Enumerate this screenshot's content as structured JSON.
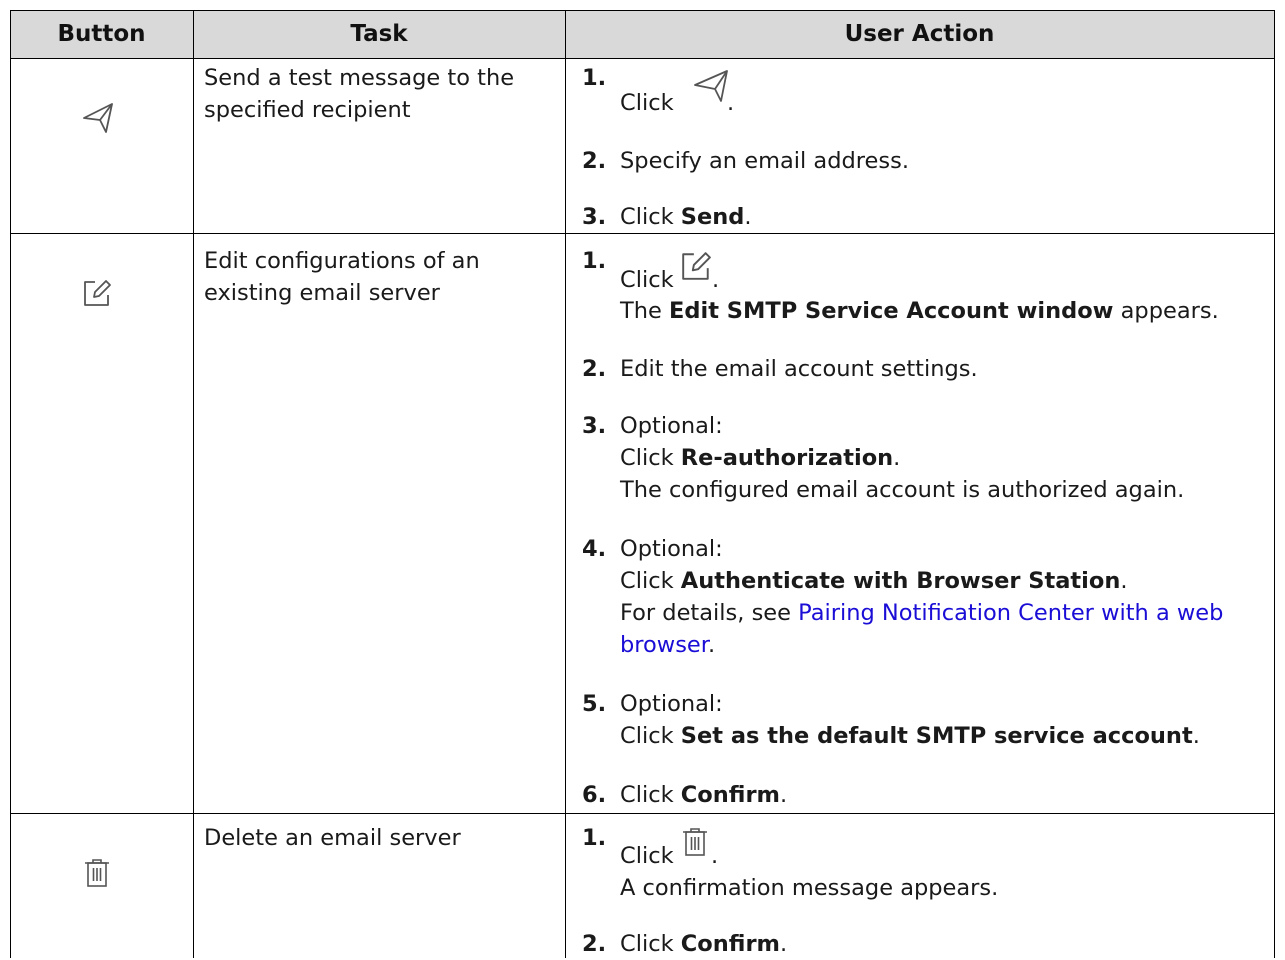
{
  "header": {
    "button": "Button",
    "task": "Task",
    "user_action": "User Action"
  },
  "rows": [
    {
      "icon": "send-icon",
      "task_lines": [
        "Send a test message to the",
        "specified recipient"
      ],
      "steps": [
        {
          "num": "1.",
          "click": "Click",
          "period": "."
        },
        {
          "num": "2.",
          "text": "Specify an email address."
        },
        {
          "num": "3.",
          "click": "Click",
          "bold": "Send",
          "period": "."
        }
      ]
    },
    {
      "icon": "edit-icon",
      "task_lines": [
        "Edit configurations of an",
        "existing email server"
      ],
      "steps": [
        {
          "num": "1.",
          "click": "Click",
          "period": ".",
          "line2_pre": "The",
          "line2_bold": "Edit SMTP Service Account window",
          "line2_post": "appears."
        },
        {
          "num": "2.",
          "text": "Edit the email account settings."
        },
        {
          "num": "3.",
          "optional": "Optional:",
          "click": "Click",
          "bold": "Re-authorization",
          "period": ".",
          "note": "The configured email account is authorized again."
        },
        {
          "num": "4.",
          "optional": "Optional:",
          "click": "Click",
          "bold": "Authenticate with Browser Station",
          "period": ".",
          "note_pre": "For details, see",
          "link_line1": "Pairing Notification Center with a web",
          "link_line2": "browser",
          "link_post": "."
        },
        {
          "num": "5.",
          "optional": "Optional:",
          "click": "Click",
          "bold": "Set as the default SMTP service account",
          "period": "."
        },
        {
          "num": "6.",
          "click": "Click",
          "bold": "Confirm",
          "period": "."
        }
      ]
    },
    {
      "icon": "trash-icon",
      "task_lines": [
        "Delete an email server"
      ],
      "steps": [
        {
          "num": "1.",
          "click": "Click",
          "period": ".",
          "note": "A confirmation message appears."
        },
        {
          "num": "2.",
          "click": "Click",
          "bold": "Confirm",
          "period": "."
        }
      ]
    }
  ]
}
